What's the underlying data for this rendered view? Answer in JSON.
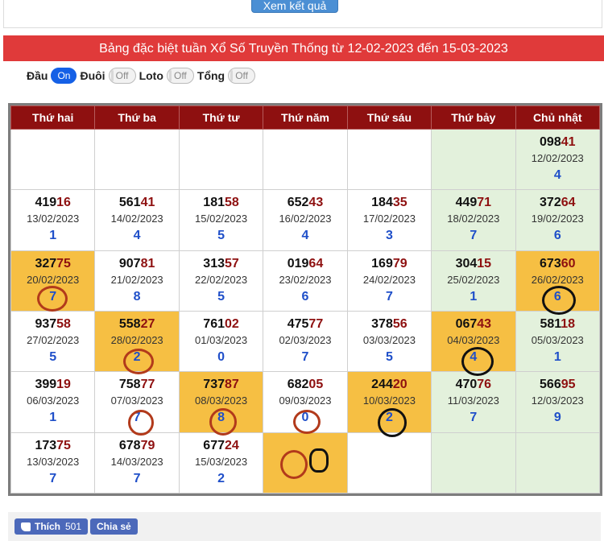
{
  "top": {
    "button_label": "Xem kết quả"
  },
  "header": {
    "title": "Bảng đặc biệt tuần Xổ Số Truyền Thống từ 12-02-2023 đến 15-03-2023"
  },
  "toggles": [
    {
      "label": "Đầu",
      "state": "On",
      "on": true
    },
    {
      "label": "Đuôi",
      "state": "Off",
      "on": false
    },
    {
      "label": "Loto",
      "state": "Off",
      "on": false
    },
    {
      "label": "Tổng",
      "state": "Off",
      "on": false
    }
  ],
  "days": [
    "Thứ hai",
    "Thứ ba",
    "Thứ tư",
    "Thứ năm",
    "Thứ sáu",
    "Thứ bảy",
    "Chủ nhật"
  ],
  "rows": [
    [
      null,
      null,
      null,
      null,
      null,
      null,
      {
        "head": "098",
        "tail": "41",
        "date": "12/02/2023",
        "val": "4"
      }
    ],
    [
      {
        "head": "419",
        "tail": "16",
        "date": "13/02/2023",
        "val": "1"
      },
      {
        "head": "561",
        "tail": "41",
        "date": "14/02/2023",
        "val": "4"
      },
      {
        "head": "181",
        "tail": "58",
        "date": "15/02/2023",
        "val": "5"
      },
      {
        "head": "652",
        "tail": "43",
        "date": "16/02/2023",
        "val": "4"
      },
      {
        "head": "184",
        "tail": "35",
        "date": "17/02/2023",
        "val": "3"
      },
      {
        "head": "449",
        "tail": "71",
        "date": "18/02/2023",
        "val": "7"
      },
      {
        "head": "372",
        "tail": "64",
        "date": "19/02/2023",
        "val": "6"
      }
    ],
    [
      {
        "head": "327",
        "tail": "75",
        "date": "20/02/2023",
        "val": "7",
        "hl": true
      },
      {
        "head": "907",
        "tail": "81",
        "date": "21/02/2023",
        "val": "8"
      },
      {
        "head": "313",
        "tail": "57",
        "date": "22/02/2023",
        "val": "5"
      },
      {
        "head": "019",
        "tail": "64",
        "date": "23/02/2023",
        "val": "6"
      },
      {
        "head": "169",
        "tail": "79",
        "date": "24/02/2023",
        "val": "7"
      },
      {
        "head": "304",
        "tail": "15",
        "date": "25/02/2023",
        "val": "1"
      },
      {
        "head": "673",
        "tail": "60",
        "date": "26/02/2023",
        "val": "6",
        "hl": true
      }
    ],
    [
      {
        "head": "937",
        "tail": "58",
        "date": "27/02/2023",
        "val": "5"
      },
      {
        "head": "558",
        "tail": "27",
        "date": "28/02/2023",
        "val": "2",
        "hl": true
      },
      {
        "head": "761",
        "tail": "02",
        "date": "01/03/2023",
        "val": "0"
      },
      {
        "head": "475",
        "tail": "77",
        "date": "02/03/2023",
        "val": "7"
      },
      {
        "head": "378",
        "tail": "56",
        "date": "03/03/2023",
        "val": "5"
      },
      {
        "head": "067",
        "tail": "43",
        "date": "04/03/2023",
        "val": "4",
        "hl": true
      },
      {
        "head": "581",
        "tail": "18",
        "date": "05/03/2023",
        "val": "1"
      }
    ],
    [
      {
        "head": "399",
        "tail": "19",
        "date": "06/03/2023",
        "val": "1"
      },
      {
        "head": "758",
        "tail": "77",
        "date": "07/03/2023",
        "val": "7"
      },
      {
        "head": "737",
        "tail": "87",
        "date": "08/03/2023",
        "val": "8",
        "hl": true
      },
      {
        "head": "682",
        "tail": "05",
        "date": "09/03/2023",
        "val": "0"
      },
      {
        "head": "244",
        "tail": "20",
        "date": "10/03/2023",
        "val": "2",
        "hl": true
      },
      {
        "head": "470",
        "tail": "76",
        "date": "11/03/2023",
        "val": "7"
      },
      {
        "head": "566",
        "tail": "95",
        "date": "12/03/2023",
        "val": "9"
      }
    ],
    [
      {
        "head": "173",
        "tail": "75",
        "date": "13/03/2023",
        "val": "7"
      },
      {
        "head": "678",
        "tail": "79",
        "date": "14/03/2023",
        "val": "7"
      },
      {
        "head": "677",
        "tail": "24",
        "date": "15/03/2023",
        "val": "2"
      },
      {
        "empty": true,
        "hl": true
      },
      null,
      null,
      null
    ]
  ],
  "social": {
    "like_label": "Thích",
    "like_count": "501",
    "share_label": "Chia sẻ"
  }
}
